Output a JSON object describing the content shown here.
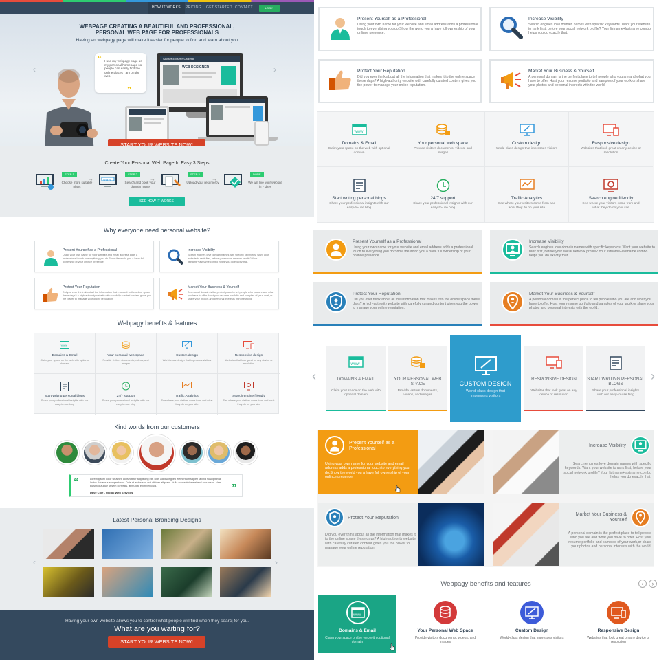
{
  "nav": {
    "items": [
      "HOW IT WORKS",
      "PRICING",
      "GET STARTED",
      "CONTACT"
    ],
    "login": "LOGIN"
  },
  "hero": {
    "title_line1": "WEBPAGE CREATING A BEAUTIFUL AND PROFESSIONAL,",
    "title_line2": "PERSONAL WEB PAGE FOR PROFESSIONALS",
    "subtitle": "Having an webpagy page will make it easier for people to find and learn about you",
    "bubble_text": "I use my webpagy page as my personal homepage so people can easily find the online places I am on the web.",
    "device_name": "SAMOKE MORROMERIE",
    "device_role": "WEB DESIGNER",
    "cta": "START YOUR WEBSITE NOW!"
  },
  "steps": {
    "title": "Create Your Personal Web Page In Easy 3 Steps",
    "items": [
      {
        "tag": "STEP 1",
        "text": "Choose more suitable plans"
      },
      {
        "tag": "STEP 2",
        "text": "Search and book your domain name"
      },
      {
        "tag": "STEP 3",
        "text": "Upload your resume/cv"
      },
      {
        "tag": "DONE",
        "text": "We will live your website in 7 days"
      }
    ],
    "button": "SEE HOW IT WORKS"
  },
  "why": {
    "title": "Why everyone need personal website?",
    "cards": [
      {
        "title": "Present Yourself as a Professional",
        "desc": "Using your own name for your website and email address adds a professional touch to everything you do.Show the world you a have full ownership of your onlince presence."
      },
      {
        "title": "Increase Visibility",
        "desc": "Search engines love domain names with specific keywords. Want your website to rank first, before your social network profile? Your listname+lastname combo helps you do exactly that."
      },
      {
        "title": "Protect Your Reputation",
        "desc": "Did you ever think about all the information that makes it to the online space these days? A high-authority website with carefully curated content gives you the power to manage your online reputation."
      },
      {
        "title": "Market Your Business & Yourself",
        "desc": "A personal domain is the perfect place to tell people who you are and what you have to offer. Host your resume portfolio and samples of your work,or share your photos and personal interests with the world."
      }
    ]
  },
  "benefits": {
    "title": "Webpagy benefits & features",
    "items": [
      {
        "title": "Domains & Email",
        "desc": "Claim your space on the web with optional domain"
      },
      {
        "title": "Your personal web space",
        "desc": "Provide visitors documents, videos, and images"
      },
      {
        "title": "Custom design",
        "desc": "World-class design that impresses visitors"
      },
      {
        "title": "Responsive design",
        "desc": "Websites that look great on any device or resolution"
      },
      {
        "title": "Start writing personal blogs",
        "desc": "Share your professional insights with our easy-to-use blog"
      },
      {
        "title": "24/7 support",
        "desc": "Share your professional insights with our easy-to-use blog"
      },
      {
        "title": "Traffic  Analytics",
        "desc": "See where your visitors come from and what they do on your site"
      },
      {
        "title": "Search engine friendly",
        "desc": "See where your visitors come from and what they do on your site"
      }
    ]
  },
  "testimonials": {
    "title": "Kind words from our customers",
    "quote": "Lorem ipsum dolor sit amet, consectetur adipiscing elit. Duis adipiscing leo elementum sapien lacinia suscipit in at lectus. Vivamus semper tortor. Duis at lectus sed orci ultrices aliquam. Nulla consectetur eleifend accumsan. Nam euismod augue ut sem convallis, at feugiat enim vehicula.",
    "author": "Dave Cole - Global Web Services"
  },
  "latest": {
    "title": "Latest Personal Branding Designs"
  },
  "footer": {
    "line": "Having your own website allows you to control what people will find when they searcj for you.",
    "headline": "What are you waiting for?",
    "cta": "START YOUR WEBSITE NOW!"
  },
  "right": {
    "cards1": [
      {
        "title": "Present Yourself as a Professional",
        "desc": "Using your own name for your website and email address adds a professional touch to everything you do.Show the world you a have full ownership of your onlince presence."
      },
      {
        "title": "Increase Visibility",
        "desc": "Search engines love domain names with specific keywords. Want your website to rank first, before your social network profile? Your listname+lastname combo helps you do exactly that."
      },
      {
        "title": "Protect Your Reputation",
        "desc": "Did you ever think about all the information that makes it to the online space these days? A high-authority website with carefully curated content gives you the power to manage your online reputation."
      },
      {
        "title": "Market Your Business & Yourself",
        "desc": "A personal domain is the perfect place to tell people who you are and what you have to offer. Host your resume portfolio and samples of your work,or share your photos and personal interests with the world."
      }
    ],
    "grid": [
      {
        "title": "Domains & Email",
        "desc": "Claim your space on the web with optional domain"
      },
      {
        "title": "Your personal web space",
        "desc": "Provide visitors documents, videos, and images"
      },
      {
        "title": "Custom design",
        "desc": "World-class design that impresses visitors"
      },
      {
        "title": "Responsive design",
        "desc": "Websites that look great on any device or resolution"
      },
      {
        "title": "Start writing personal blogs",
        "desc": "Share your professional insights with our easy-to-use blog"
      },
      {
        "title": "24/7 support",
        "desc": "Share your professional insights with our easy-to-use blog"
      },
      {
        "title": "Traffic  Analytics",
        "desc": "See where your visitors come from and what they do on your site"
      },
      {
        "title": "Search engine friendly",
        "desc": "See where your visitors come from and what they do on your site"
      }
    ],
    "features": [
      {
        "title": "DOMAINS & EMAIL",
        "desc": "Claim your space on the web with optional domain"
      },
      {
        "title": "YOUR PERSONAL WEB SPACE",
        "desc": "Provide visitors documents, videos, and images"
      },
      {
        "title": "CUSTOM DESIGN",
        "desc": "World-class design that impresses visitors"
      },
      {
        "title": "RESPONSIVE DESIGN",
        "desc": "Websites that look great on any device or resolution"
      },
      {
        "title": "START WRITING PERSONAL BLOGS",
        "desc": "Share your professional insights with our easy-to-use blog"
      }
    ],
    "photo_cards": [
      {
        "title": "Present Yourself as a Professional",
        "desc": "Using your own name for your website and email address adds a professional touch to everything you do.Show the world you a have full ownership of your onlince presence."
      },
      {
        "title": "Increase Visibility",
        "desc": "Search engines love domain names with specific keywords. Want your website to rank first, before your social network profile? Your listname+lastname combo helps you do exactly that."
      },
      {
        "title": "Protect Your Reputation",
        "desc": "Did you ever think about all the information that makes it to the online space these days? A high-authority website with carefully curated content gives you the power to manage your online reputation."
      },
      {
        "title": "Market Your Business & Yourself",
        "desc": "A personal domain is the perfect place to tell people who you are and what you have to offer. Host your resume,portfolio and samples of your work,or share your photos and personal interests with the world."
      }
    ],
    "benefits_title": "Webpagy benefits and features",
    "benefits": [
      {
        "title": "Domains & Email",
        "desc": "Claim your space on the web with optional domain"
      },
      {
        "title": "Your Personal Web Space",
        "desc": "Provide visitors documents, videos, and images"
      },
      {
        "title": "Custom Design",
        "desc": "World-class design that impresses visitors"
      },
      {
        "title": "Responsive Design",
        "desc": "Websites that look great on any device or resolution"
      }
    ]
  },
  "colors": {
    "dark": "#34495e",
    "green": "#2ecc71",
    "teal": "#1abc9c",
    "red": "#d64228",
    "blue": "#2980b9",
    "orange": "#f39c12"
  }
}
